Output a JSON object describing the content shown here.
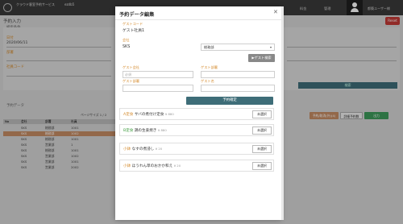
{
  "app": {
    "title": "クラウド客室予約サービス",
    "subtitle": "ezdb5",
    "nav": [
      "料金",
      "管理"
    ],
    "user": "都築ユーザー様"
  },
  "background": {
    "page_title": "予約入力",
    "search_header": "検索条件",
    "reset_label": "Reset",
    "date_label": "日付",
    "date_value": "2020/06/11",
    "dept_label": "部署",
    "company_code_label": "社員コード",
    "search_button": "検索",
    "grid_title": "予約データ",
    "pager_text": "ページサイズ 1 / 2",
    "grid_headers": [
      "No",
      "会社",
      "部署",
      "社員"
    ],
    "grid_rows": [
      {
        "no": "",
        "company": "SKS",
        "dept": "総務部",
        "code": "1001"
      },
      {
        "no": "",
        "company": "SKS",
        "dept": "総務部",
        "code": "1002"
      },
      {
        "no": "",
        "company": "SKS",
        "dept": "総務部",
        "code": "1001"
      },
      {
        "no": "",
        "company": "SKS",
        "dept": "営業部",
        "code": "1"
      },
      {
        "no": "",
        "company": "SKS",
        "dept": "総務部",
        "code": "1001"
      },
      {
        "no": "",
        "company": "SKS",
        "dept": "営業部",
        "code": "1002"
      },
      {
        "no": "",
        "company": "SKS",
        "dept": "営業部",
        "code": "1001"
      },
      {
        "no": "",
        "company": "SKS",
        "dept": "営業部",
        "code": "2002"
      }
    ],
    "btn_status": "予約/取消(外)(4)",
    "btn_detail": "詳細予約数",
    "btn_output": "出力"
  },
  "modal": {
    "title": "予約データ編集",
    "guest_code_label": "ゲストコード",
    "guest_code_value": "ゲスト社員1",
    "company_label": "会社",
    "company_value": "SKS",
    "dept_select_value": "総務部",
    "guest_search_button": "▶ゲスト検索",
    "guest_company_label": "ゲスト会社",
    "guest_company_placeholder": "必須",
    "guest_dept_label": "ゲスト部署",
    "guest_name_label": "ゲスト名",
    "guest_office_label": "ゲスト部署",
    "confirm_button": "予約確定",
    "cards": [
      {
        "category": "A定食",
        "name": "サバの煮付け定食",
        "price": "¥ 880",
        "button": "未選択",
        "green": false
      },
      {
        "category": "B定食",
        "name": "鶏の生姜焼き",
        "price": "¥ 880",
        "button": "未選択",
        "green": true
      },
      {
        "category": "小鉢",
        "name": "なすの煮浸し",
        "price": "¥ 20",
        "button": "未選択",
        "green": false
      },
      {
        "category": "小鉢",
        "name": "ほうれん草のおかか和え",
        "price": "¥ 20",
        "button": "未選択",
        "green": false
      }
    ]
  },
  "colors": {
    "accent_orange": "#d48a2c",
    "teal_button": "#3e6d78",
    "reset_red": "#c23a36",
    "selected_row": "#c58b63"
  }
}
